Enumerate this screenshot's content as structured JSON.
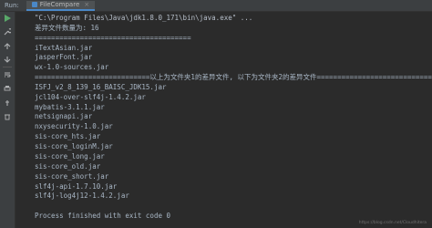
{
  "run_panel": {
    "label": "Run:",
    "tab_label": "FileCompare",
    "tab_close": "×"
  },
  "toolbar": {
    "icons": [
      "play-icon",
      "wrench-icon",
      "up-arrow-icon",
      "down-arrow-icon",
      "soft-wrap-icon",
      "print-icon",
      "pin-icon",
      "delete-icon"
    ]
  },
  "console": {
    "lines": [
      "\"C:\\Program Files\\Java\\jdk1.8.0_171\\bin\\java.exe\" ...",
      "差异文件数量为: 16",
      "======================================",
      "iTextAsian.jar",
      "jasperFont.jar",
      "wx-1.0-sources.jar",
      "============================以上为文件夹1的差异文件, 以下为文件夹2的差异文件============================",
      "ISFJ_v2_8_139_16_BAISC_JDK15.jar",
      "jcl104-over-slf4j-1.4.2.jar",
      "mybatis-3.1.1.jar",
      "netsignapi.jar",
      "nxysecurity-1.0.jar",
      "sis-core_hts.jar",
      "sis-core_loginM.jar",
      "sis-core_long.jar",
      "sis-core_old.jar",
      "sis-core_short.jar",
      "slf4j-api-1.7.10.jar",
      "slf4j-log4j12-1.4.2.jar",
      "",
      "Process finished with exit code 0"
    ]
  },
  "watermark": "https://blog.csdn.net/Cloudhitera"
}
